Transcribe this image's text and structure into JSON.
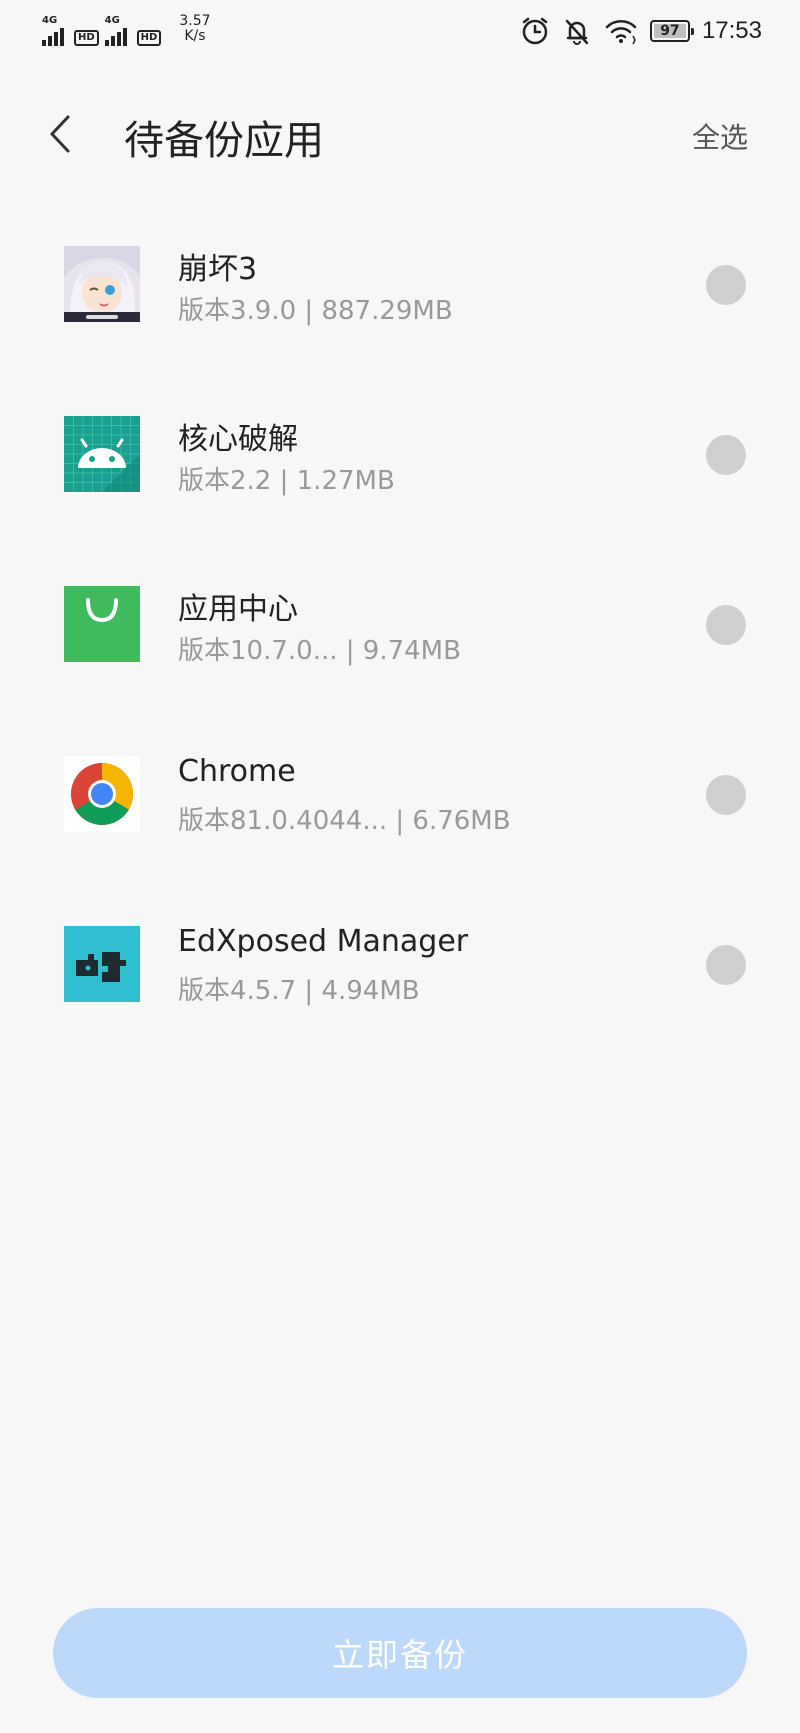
{
  "status_bar": {
    "network_1": "4G",
    "network_2": "4G",
    "hd_1": "HD",
    "hd_2": "HD",
    "speed_value": "3.57",
    "speed_unit": "K/s",
    "battery": "97",
    "time": "17:53",
    "icons": [
      "alarm-icon",
      "bell-muted-icon",
      "wifi-icon"
    ]
  },
  "header": {
    "title": "待备份应用",
    "select_all": "全选"
  },
  "apps": [
    {
      "name": "崩坏3",
      "meta": "版本3.9.0 | 887.29MB",
      "icon": "honkai-app-icon",
      "selected": false
    },
    {
      "name": "核心破解",
      "meta": "版本2.2 | 1.27MB",
      "icon": "android-app-icon",
      "selected": false
    },
    {
      "name": "应用中心",
      "meta": "版本10.7.0... | 9.74MB",
      "icon": "app-center-icon",
      "selected": false
    },
    {
      "name": "Chrome",
      "meta": "版本81.0.4044... | 6.76MB",
      "icon": "chrome-icon",
      "selected": false
    },
    {
      "name": "EdXposed Manager",
      "meta": "版本4.5.7 | 4.94MB",
      "icon": "edxposed-icon",
      "selected": false
    }
  ],
  "footer": {
    "backup_label": "立即备份"
  },
  "colors": {
    "background": "#f7f7f7",
    "button": "#bcd8fa",
    "radio": "#cfcfcf"
  }
}
